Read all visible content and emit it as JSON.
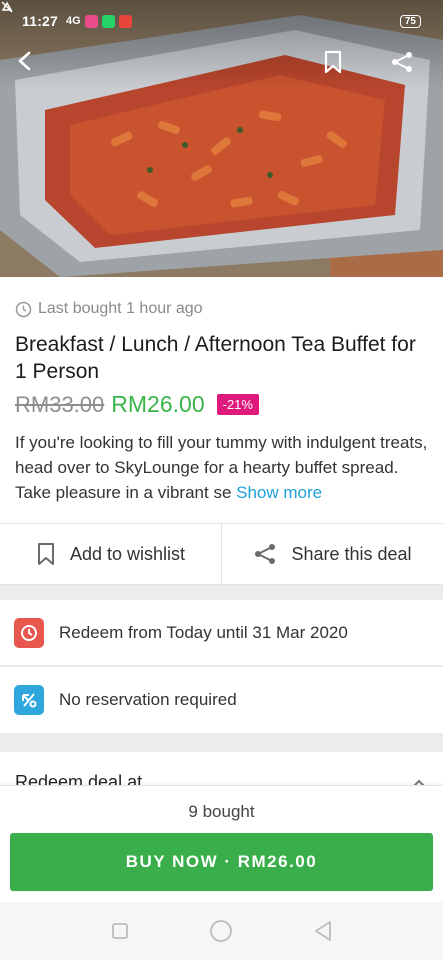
{
  "status_bar": {
    "time": "11:27",
    "signal": "4G",
    "battery": "75",
    "notif_colors": [
      "#ea4c89",
      "#25d366",
      "#e8453c"
    ]
  },
  "hero": {
    "back_icon": "back-arrow-icon",
    "bookmark_icon": "bookmark-icon",
    "share_icon": "share-icon"
  },
  "deal": {
    "last_bought": "Last bought 1 hour ago",
    "title": "Breakfast / Lunch / Afternoon Tea Buffet for 1 Person",
    "old_price": "RM33.00",
    "new_price": "RM26.00",
    "discount": "-21%",
    "description": "If you're looking to fill your tummy with indulgent treats, head over to SkyLounge for a hearty buffet spread. Take pleasure in a vibrant se",
    "show_more": "Show more"
  },
  "actions": {
    "wishlist_label": "Add to wishlist",
    "share_label": "Share this deal"
  },
  "info": {
    "redeem_period": "Redeem from Today until 31 Mar 2020",
    "reservation": "No reservation required",
    "redeem_at": "Redeem deal at"
  },
  "bottom_bar": {
    "bought_count": "9 bought",
    "buy_label": "BUY NOW · RM26.00"
  },
  "colors": {
    "accent_green": "#3aae4a",
    "discount_pink": "#e0197d",
    "link_blue": "#1fa0d8",
    "clock_red": "#e8574d",
    "reservation_blue": "#2fa6dc"
  }
}
